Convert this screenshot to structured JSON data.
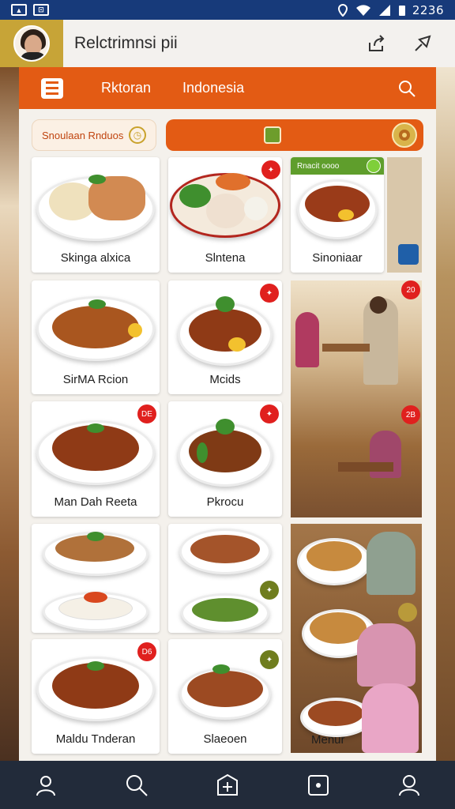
{
  "status_bar": {
    "time": "2236",
    "left_badges": [
      "▲",
      "⊡"
    ]
  },
  "top_bar": {
    "title": "Relctrimnsi pii"
  },
  "header": {
    "tabs": [
      "Rktoran",
      "Indonesia"
    ]
  },
  "filters": {
    "chip_label": "Snoulaan Rnduos"
  },
  "cards": {
    "c1": {
      "label": "Skinga alxica"
    },
    "c2": {
      "label": "Slntena"
    },
    "c3": {
      "label": "Sinoniaar",
      "promo": "Rnacit oooo"
    },
    "c4": {
      "label": "SirMA Rcion"
    },
    "c5": {
      "label": "Mcids"
    },
    "c6": {
      "label": "Man Dah Reeta"
    },
    "c7": {
      "label": "Pkrocu"
    },
    "c8": {
      "label": "Maldu Tnderan"
    },
    "c9": {
      "label": "Slaeoen"
    },
    "c10": {
      "label": "Menur"
    }
  },
  "badges": {
    "b1": "20",
    "b2": "2B",
    "b3": "DE",
    "b4": "D6"
  },
  "colors": {
    "accent": "#e35b14",
    "status_bar": "#173a7a",
    "nav": "#222b3a",
    "badge_red": "#e0201e",
    "promo_green": "#5f9e2c"
  },
  "icons": [
    "share-icon",
    "pin-icon",
    "menu-icon",
    "search-icon",
    "user-icon",
    "search-nav-icon",
    "add-icon",
    "grid-icon",
    "profile-icon"
  ]
}
